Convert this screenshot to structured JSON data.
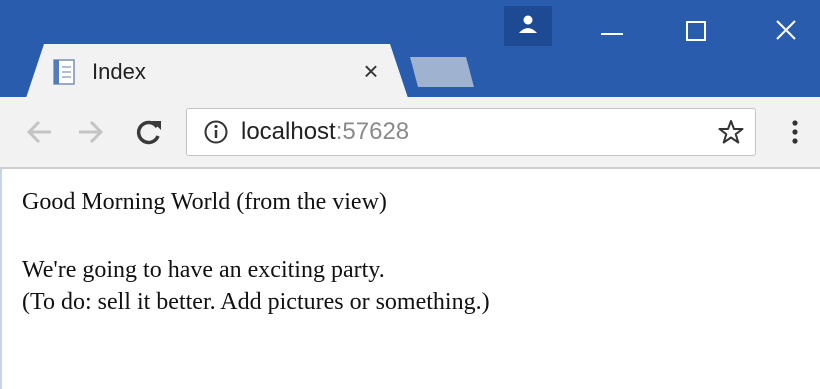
{
  "tab": {
    "title": "Index",
    "close_symbol": "×"
  },
  "address_bar": {
    "host": "localhost",
    "port": ":57628"
  },
  "page": {
    "heading": "Good Morning World (from the view)",
    "line1": "We're going to have an exciting party.",
    "line2": "(To do: sell it better. Add pictures or something.)"
  },
  "icons": {
    "favicon": "page-icon",
    "profile": "person-icon",
    "minimize": "minimize-icon",
    "maximize": "maximize-icon",
    "close": "close-icon",
    "back": "arrow-left-icon",
    "forward": "arrow-right-icon",
    "reload": "reload-icon",
    "info": "info-icon",
    "bookmark": "star-icon",
    "menu": "kebab-menu-icon"
  },
  "colors": {
    "titlebar": "#2a5cae",
    "toolbar": "#f2f2f2",
    "new_tab": "#9fb2cf"
  }
}
